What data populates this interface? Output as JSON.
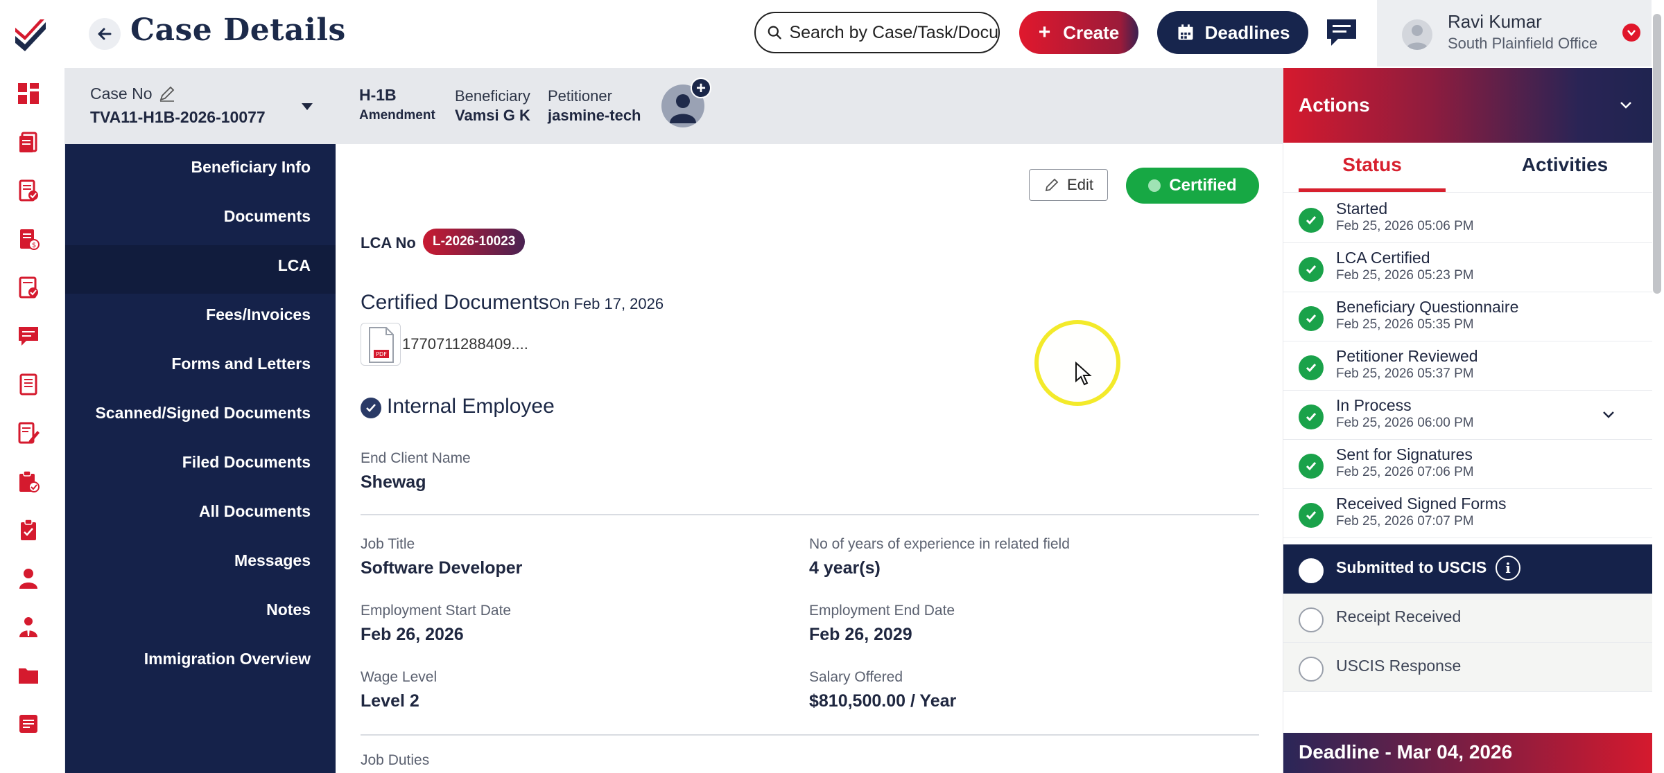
{
  "header": {
    "title": "Case Details",
    "search_placeholder": "Search by Case/Task/Docu",
    "create_label": "Create",
    "deadlines_label": "Deadlines",
    "user_name": "Ravi Kumar",
    "user_office": "South Plainfield Office"
  },
  "case_bar": {
    "case_no_label": "Case No",
    "case_no": "TVA11-H1B-2026-10077",
    "visa_type": "H-1B",
    "visa_subtype": "Amendment",
    "beneficiary_label": "Beneficiary",
    "beneficiary": "Vamsi G K",
    "petitioner_label": "Petitioner",
    "petitioner": "jasmine-tech"
  },
  "section_nav": {
    "items": [
      {
        "label": "Beneficiary Info"
      },
      {
        "label": "Documents"
      },
      {
        "label": "LCA",
        "active": true
      },
      {
        "label": "Fees/Invoices"
      },
      {
        "label": "Forms and Letters"
      },
      {
        "label": "Scanned/Signed Documents"
      },
      {
        "label": "Filed Documents"
      },
      {
        "label": "All Documents"
      },
      {
        "label": "Messages"
      },
      {
        "label": "Notes"
      },
      {
        "label": "Immigration Overview"
      }
    ]
  },
  "lca": {
    "edit_label": "Edit",
    "status_badge": "Certified",
    "lca_no_label": "LCA No",
    "lca_no": "L-2026-10023",
    "certified_docs_title": "Certified Documents",
    "certified_docs_date": "On Feb 17, 2026",
    "file_name": "1770711288409....",
    "file_type": "PDF",
    "employee_type": "Internal Employee",
    "fields": {
      "end_client_label": "End Client Name",
      "end_client": "Shewag",
      "job_title_label": "Job Title",
      "job_title": "Software Developer",
      "experience_label": "No of years of experience in related field",
      "experience": "4 year(s)",
      "start_date_label": "Employment Start Date",
      "start_date": "Feb 26, 2026",
      "end_date_label": "Employment End Date",
      "end_date": "Feb 26, 2029",
      "wage_level_label": "Wage Level",
      "wage_level": "Level 2",
      "salary_label": "Salary Offered",
      "salary": "$810,500.00 / Year",
      "job_duties_label": "Job Duties"
    }
  },
  "actions": {
    "title": "Actions",
    "tab_status": "Status",
    "tab_activities": "Activities",
    "statuses": [
      {
        "name": "Started",
        "date": "Feb 25, 2026 05:06 PM",
        "state": "done"
      },
      {
        "name": "LCA Certified",
        "date": "Feb 25, 2026 05:23 PM",
        "state": "done"
      },
      {
        "name": "Beneficiary Questionnaire",
        "date": "Feb 25, 2026 05:35 PM",
        "state": "done"
      },
      {
        "name": "Petitioner Reviewed",
        "date": "Feb 25, 2026 05:37 PM",
        "state": "done"
      },
      {
        "name": "In Process",
        "date": "Feb 25, 2026 06:00 PM",
        "state": "done"
      },
      {
        "name": "Sent for Signatures",
        "date": "Feb 25, 2026 07:06 PM",
        "state": "done"
      },
      {
        "name": "Received Signed Forms",
        "date": "Feb 25, 2026 07:07 PM",
        "state": "done"
      },
      {
        "name": "Submitted to USCIS",
        "state": "current"
      },
      {
        "name": "Receipt Received",
        "state": "pending"
      },
      {
        "name": "USCIS Response",
        "state": "pending"
      }
    ],
    "deadline": "Deadline - Mar 04, 2026"
  },
  "colors": {
    "navy": "#15224a",
    "brand_red": "#d51a2e",
    "success_green": "#1aa24a"
  }
}
